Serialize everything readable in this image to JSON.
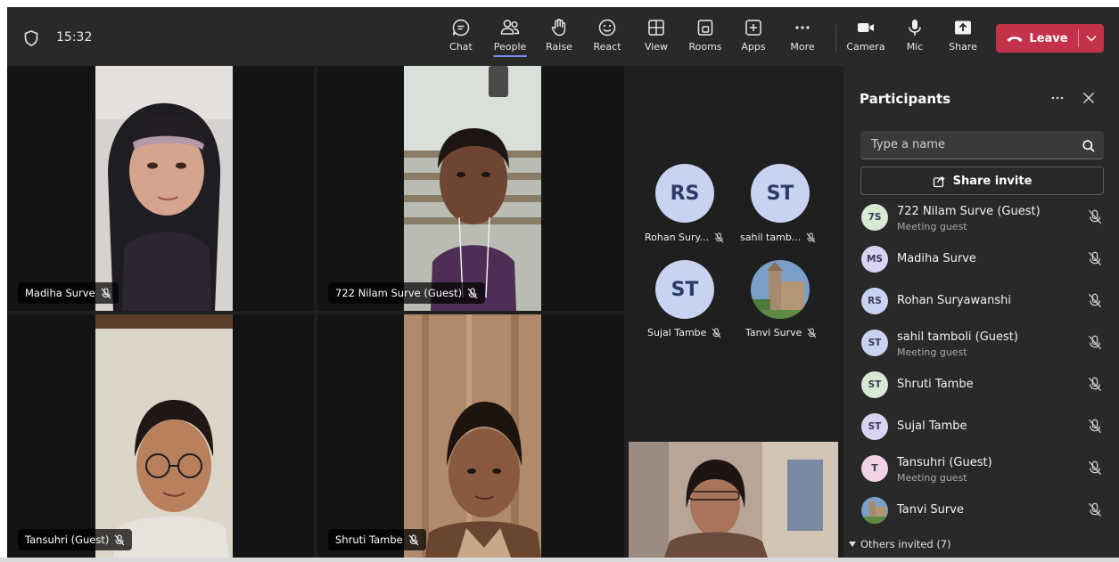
{
  "toolbar": {
    "time": "15:32",
    "buttons": [
      {
        "id": "chat",
        "label": "Chat",
        "icon": "chat-icon"
      },
      {
        "id": "people",
        "label": "People",
        "icon": "people-icon",
        "active": true
      },
      {
        "id": "raise",
        "label": "Raise",
        "icon": "hand-icon"
      },
      {
        "id": "react",
        "label": "React",
        "icon": "smiley-icon"
      },
      {
        "id": "view",
        "label": "View",
        "icon": "grid-icon"
      },
      {
        "id": "rooms",
        "label": "Rooms",
        "icon": "rooms-icon"
      },
      {
        "id": "apps",
        "label": "Apps",
        "icon": "plus-square-icon"
      },
      {
        "id": "more",
        "label": "More",
        "icon": "ellipsis-icon"
      },
      {
        "id": "camera",
        "label": "Camera",
        "icon": "camera-icon"
      },
      {
        "id": "mic",
        "label": "Mic",
        "icon": "mic-icon"
      },
      {
        "id": "share",
        "label": "Share",
        "icon": "share-upload-icon"
      }
    ],
    "leave_label": "Leave",
    "accent_color": "#c4314b",
    "active_underline_color": "#7f85f5"
  },
  "stage": {
    "video_tiles": [
      {
        "name": "Madiha Surve",
        "muted": true
      },
      {
        "name": "722 Nilam Surve (Guest)",
        "muted": true
      },
      {
        "name": "Tansuhri (Guest)",
        "muted": true
      },
      {
        "name": "Shruti Tambe",
        "muted": true
      }
    ],
    "avatar_tiles": [
      {
        "initials": "RS",
        "name": "Rohan Sury...",
        "muted": true
      },
      {
        "initials": "ST",
        "name": "sahil tamb...",
        "muted": true
      },
      {
        "initials": "ST",
        "name": "Sujal Tambe",
        "muted": true
      },
      {
        "initials": "",
        "name": "Tanvi Surve",
        "muted": true,
        "photo": "building-photo"
      }
    ]
  },
  "panel": {
    "title": "Participants",
    "search_placeholder": "Type a name",
    "share_invite_label": "Share invite",
    "participants": [
      {
        "initials": "7S",
        "name": "722 Nilam Surve (Guest)",
        "sub": "Meeting guest",
        "color": "#d6ead2",
        "muted": true
      },
      {
        "initials": "MS",
        "name": "Madiha Surve",
        "sub": "",
        "color": "#d9d3f2",
        "muted": true
      },
      {
        "initials": "RS",
        "name": "Rohan Suryawanshi",
        "sub": "",
        "color": "#c7d3f0",
        "muted": true
      },
      {
        "initials": "ST",
        "name": "sahil tamboli (Guest)",
        "sub": "Meeting guest",
        "color": "#c7d3f0",
        "muted": true
      },
      {
        "initials": "ST",
        "name": "Shruti Tambe",
        "sub": "",
        "color": "#d6ead2",
        "muted": true
      },
      {
        "initials": "ST",
        "name": "Sujal Tambe",
        "sub": "",
        "color": "#d9d3f2",
        "muted": true
      },
      {
        "initials": "T",
        "name": "Tansuhri (Guest)",
        "sub": "Meeting guest",
        "color": "#f2d3e6",
        "muted": true
      },
      {
        "initials": "",
        "name": "Tanvi Surve",
        "sub": "",
        "color": "#8aa0b8",
        "muted": true,
        "photo": "building-photo"
      }
    ],
    "others_invited_label": "Others invited (7)"
  }
}
